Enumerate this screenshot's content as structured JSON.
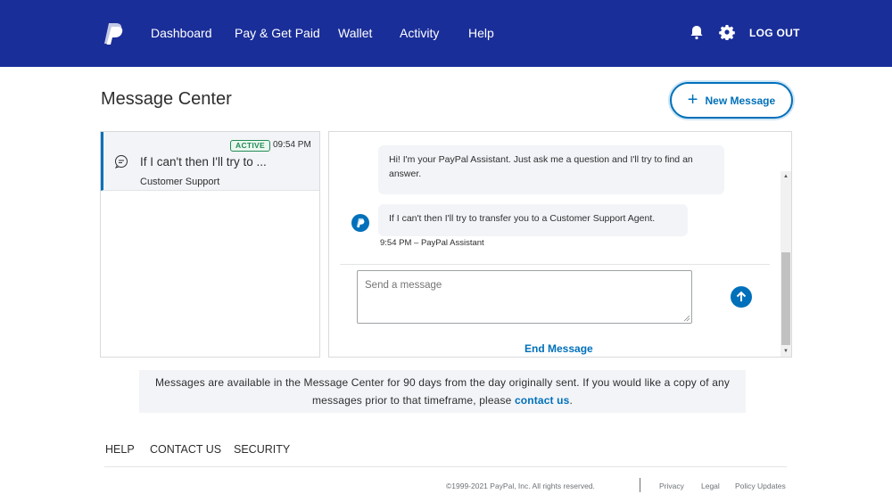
{
  "header": {
    "nav": [
      "Dashboard",
      "Pay & Get Paid",
      "Wallet",
      "Activity",
      "Help"
    ],
    "logout": "LOG OUT",
    "icons": [
      "paypal-logo",
      "bell-icon",
      "gear-icon"
    ]
  },
  "page": {
    "title": "Message Center",
    "new_message": "New Message"
  },
  "conversation_list": [
    {
      "status": "ACTIVE",
      "time": "09:54 PM",
      "preview": "If I can't then I'll try to ...",
      "sender": "Customer Support"
    }
  ],
  "chat": {
    "messages": [
      {
        "text": "Hi! I'm your PayPal Assistant. Just ask me a question and I'll try to find an answer."
      },
      {
        "text": "If I can't then I'll try to transfer you to a Customer Support Agent."
      }
    ],
    "meta": "9:54 PM – PayPal Assistant",
    "input_placeholder": "Send a message",
    "end_message": "End Message"
  },
  "info": {
    "text": "Messages are available in the Message Center for 90 days from the day originally sent. If you would like a copy of any messages prior to that timeframe, please",
    "link": "contact us",
    "suffix": "."
  },
  "footer": {
    "links": [
      "HELP",
      "CONTACT US",
      "SECURITY"
    ],
    "copyright": "©1999-2021 PayPal, Inc. All rights reserved.",
    "legal_links": [
      "Privacy",
      "Legal",
      "Policy Updates"
    ]
  },
  "colors": {
    "header_bg": "#1a2e99",
    "link_blue": "#0070ba",
    "active_green": "#238b57",
    "panel_gray": "#f2f4f7"
  }
}
